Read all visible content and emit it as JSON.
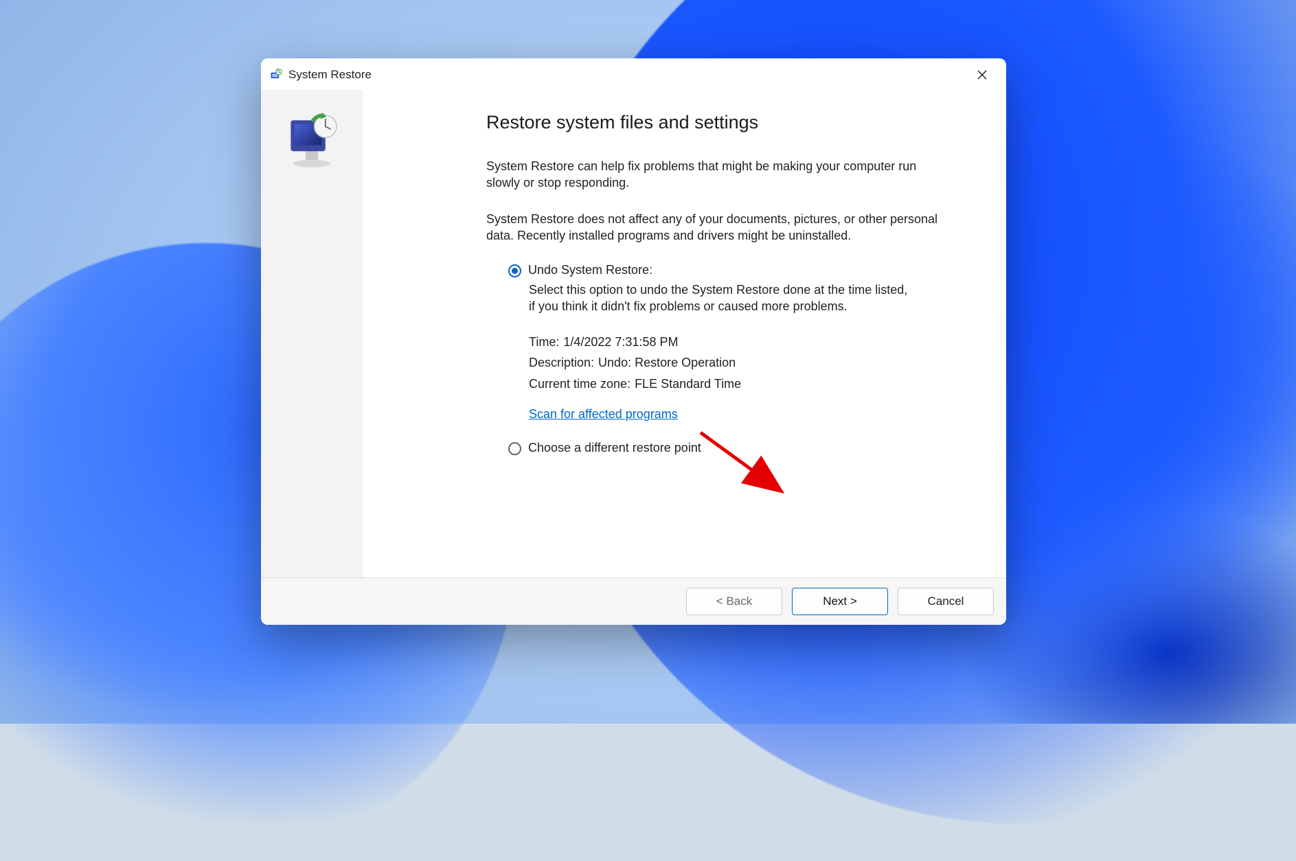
{
  "dialog": {
    "title": "System Restore",
    "heading": "Restore system files and settings",
    "paragraph1": "System Restore can help fix problems that might be making your computer run slowly or stop responding.",
    "paragraph2": "System Restore does not affect any of your documents, pictures, or other personal data. Recently installed programs and drivers might be uninstalled.",
    "option1": {
      "label": "Undo System Restore:",
      "description": "Select this option to undo the System Restore done at the time listed, if you think it didn't fix problems or caused more problems.",
      "time_label": "Time:",
      "time_value": "1/4/2022 7:31:58 PM",
      "desc_label": "Description:",
      "desc_value": "Undo: Restore Operation",
      "tz_label": "Current time zone:",
      "tz_value": "FLE Standard Time"
    },
    "scan_link": "Scan for affected programs",
    "option2_label": "Choose a different restore point",
    "buttons": {
      "back": "< Back",
      "next": "Next >",
      "cancel": "Cancel"
    }
  }
}
